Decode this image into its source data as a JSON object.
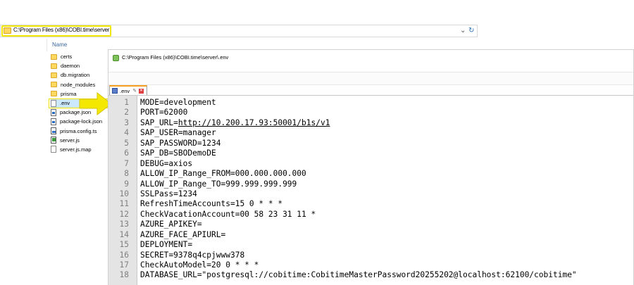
{
  "explorer": {
    "address_path": "C:\\Program Files (x86)\\COBI.time\\server",
    "name_header": "Name",
    "files": [
      {
        "name": "certs",
        "icon": "folder-icon",
        "kind": "folder"
      },
      {
        "name": "daemon",
        "icon": "folder-icon",
        "kind": "folder"
      },
      {
        "name": "db.migration",
        "icon": "folder-icon",
        "kind": "folder"
      },
      {
        "name": "node_modules",
        "icon": "folder-icon",
        "kind": "folder"
      },
      {
        "name": "prisma",
        "icon": "folder-icon",
        "kind": "folder"
      },
      {
        "name": ".env",
        "icon": "file-icon",
        "kind": "doc",
        "selected": true
      },
      {
        "name": "package.json",
        "icon": "json-file-icon",
        "kind": "json"
      },
      {
        "name": "package-lock.json",
        "icon": "json-file-icon",
        "kind": "json"
      },
      {
        "name": "prisma.config.ts",
        "icon": "ts-file-icon",
        "kind": "ts"
      },
      {
        "name": "server.js",
        "icon": "js-file-icon",
        "kind": "js"
      },
      {
        "name": "server.js.map",
        "icon": "file-icon",
        "kind": "doc"
      }
    ]
  },
  "editor": {
    "title": "C:\\Program Files (x86)\\COBI.time\\server\\.env",
    "tab_label": ".env",
    "lines": [
      {
        "n": "1",
        "text": "MODE=development"
      },
      {
        "n": "2",
        "text": "PORT=62000"
      },
      {
        "n": "3",
        "prefix": "SAP_URL=",
        "link": "http://10.200.17.93:50001/b1s/v1"
      },
      {
        "n": "4",
        "text": "SAP_USER=manager"
      },
      {
        "n": "5",
        "text": "SAP_PASSWORD=1234"
      },
      {
        "n": "6",
        "text": "SAP_DB=SBODemoDE"
      },
      {
        "n": "7",
        "text": "DEBUG=axios"
      },
      {
        "n": "8",
        "text": "ALLOW_IP_Range_FROM=000.000.000.000"
      },
      {
        "n": "9",
        "text": "ALLOW_IP_Range_TO=999.999.999.999"
      },
      {
        "n": "10",
        "text": "SSLPass=1234"
      },
      {
        "n": "11",
        "text": "RefreshTimeAccounts=15 0 * * *"
      },
      {
        "n": "12",
        "text": "CheckVacationAccount=00 58 23 31 11 *"
      },
      {
        "n": "13",
        "text": "AZURE_APIKEY="
      },
      {
        "n": "14",
        "text": "AZURE_FACE_APIURL="
      },
      {
        "n": "15",
        "text": "DEPLOYMENT="
      },
      {
        "n": "16",
        "text": "SECRET=9378q4cpjwww378"
      },
      {
        "n": "17",
        "text": "CheckAutoModel=20 0 * * *"
      },
      {
        "n": "18",
        "text": "DATABASE_URL=\"postgresql://cobitime:CobitimeMasterPassword20255202@localhost:62100/cobitime\""
      }
    ]
  },
  "colors": {
    "highlight": "#f2e600",
    "arrow": "#f5e800",
    "tab_accent": "#f7a020",
    "gutter": "#e4e4e4"
  }
}
